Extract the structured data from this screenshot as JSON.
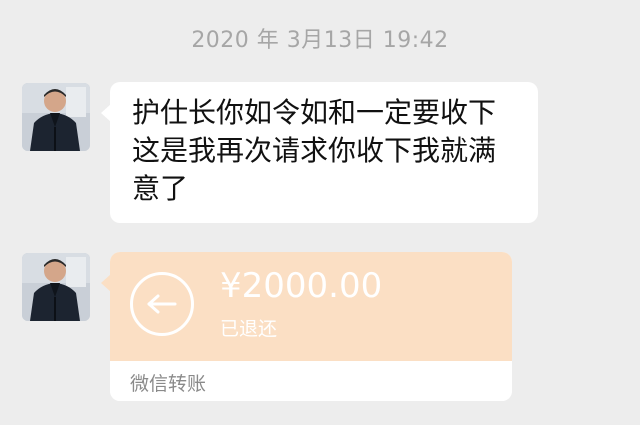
{
  "chat": {
    "timestamp": "2020 年 3月13日 19:42",
    "message": {
      "lines": [
        "护仕长你如令如和一定要收下",
        "这是我再次请求你收下我就满",
        "意了"
      ]
    },
    "transfer": {
      "amount": "¥2000.00",
      "status": "已退还",
      "label": "微信转账",
      "icon": "return-arrow-icon"
    },
    "colors": {
      "background": "#ededed",
      "bubble": "#ffffff",
      "transfer_top": "#fbdfc4",
      "timestamp": "#a6a6a6"
    }
  }
}
